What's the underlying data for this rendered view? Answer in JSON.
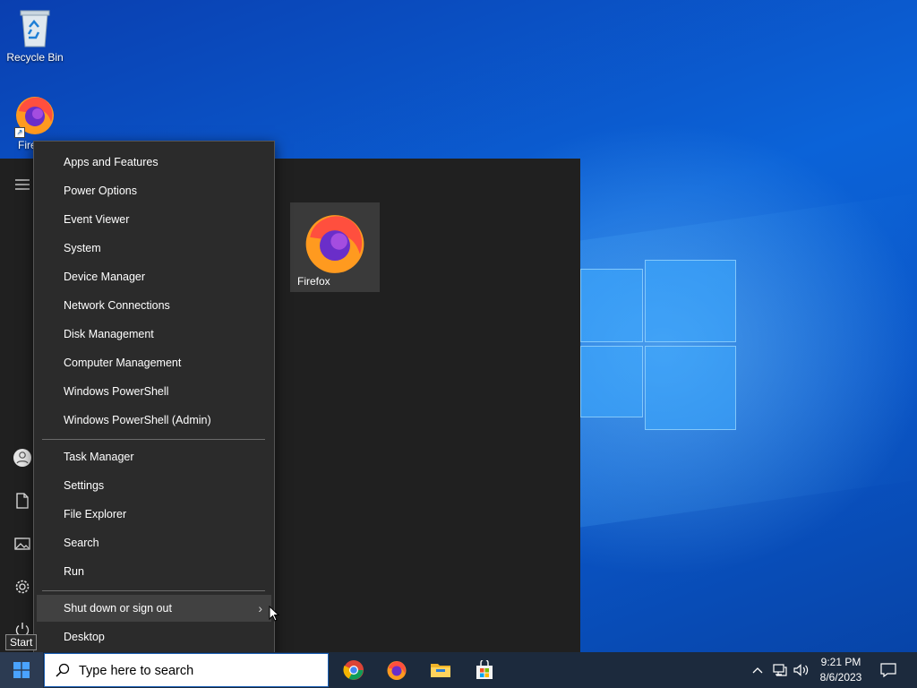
{
  "desktop": {
    "icons": [
      {
        "label": "Recycle Bin",
        "icon": "recycle-bin-icon"
      },
      {
        "label": "Fire",
        "icon": "firefox-icon"
      }
    ]
  },
  "start_menu": {
    "tile": {
      "label": "Firefox",
      "icon": "firefox-icon"
    },
    "rail_icons": [
      "hamburger-menu-icon",
      "user-icon",
      "document-icon",
      "pictures-icon",
      "settings-icon",
      "power-icon"
    ]
  },
  "winx_menu": {
    "group1": [
      "Apps and Features",
      "Power Options",
      "Event Viewer",
      "System",
      "Device Manager",
      "Network Connections",
      "Disk Management",
      "Computer Management",
      "Windows PowerShell",
      "Windows PowerShell (Admin)"
    ],
    "group2": [
      "Task Manager",
      "Settings",
      "File Explorer",
      "Search",
      "Run"
    ],
    "group3": [
      "Shut down or sign out",
      "Desktop"
    ]
  },
  "tooltip": {
    "text": "Start"
  },
  "taskbar": {
    "search_placeholder": "Type here to search",
    "apps": [
      "chrome-icon",
      "firefox-icon",
      "file-explorer-icon",
      "microsoft-store-icon"
    ],
    "clock": {
      "time": "9:21 PM",
      "date": "8/6/2023"
    }
  },
  "colors": {
    "menu_bg": "#2b2b2b",
    "start_panel_bg": "#202020",
    "taskbar_bg": "#1c2a3d",
    "wallpaper": "#0b55c8"
  }
}
